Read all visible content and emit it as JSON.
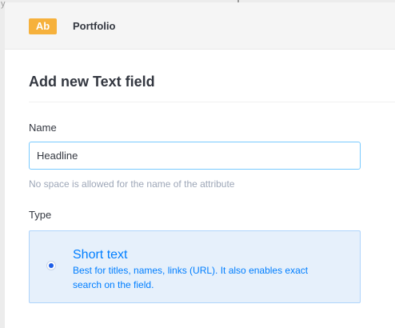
{
  "backdrop": {
    "glyph": "y"
  },
  "header": {
    "badge": "Ab",
    "content_type": "Portfolio"
  },
  "modal": {
    "title": "Add new Text field"
  },
  "form": {
    "name_label": "Name",
    "name_value": "Headline",
    "name_hint": "No space is allowed for the name of the attribute",
    "type_label": "Type",
    "options": [
      {
        "title": "Short text",
        "description": "Best for titles, names, links (URL). It also enables exact search on the field.",
        "selected": true
      }
    ]
  },
  "colors": {
    "accent": "#007eff",
    "badge": "#f6b13c",
    "input_focus_border": "#78caff",
    "option_background": "#e6f0fb"
  }
}
